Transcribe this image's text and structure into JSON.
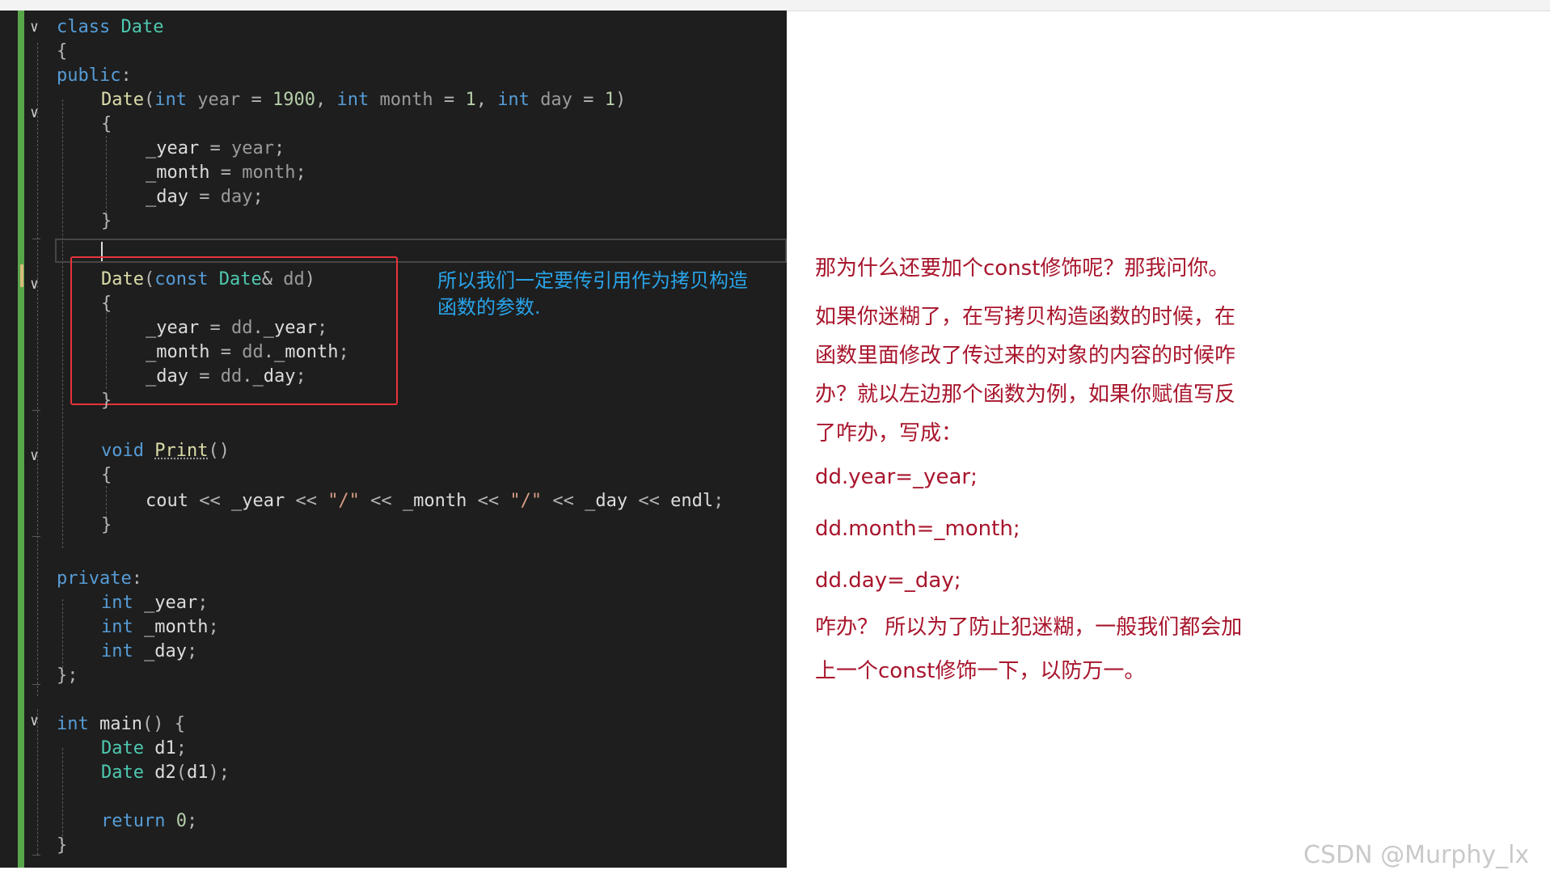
{
  "code": {
    "l1": [
      "class",
      " ",
      "Date"
    ],
    "l2": [
      "{"
    ],
    "l3": [
      "public",
      ":"
    ],
    "l4": [
      "Date",
      "(",
      "int",
      " ",
      "year",
      " = ",
      "1900",
      ", ",
      "int",
      " ",
      "month",
      " = ",
      "1",
      ", ",
      "int",
      " ",
      "day",
      " = ",
      "1",
      ")"
    ],
    "l5": [
      "{"
    ],
    "l6": [
      "_year",
      " = ",
      "year",
      ";"
    ],
    "l7": [
      "_month",
      " = ",
      "month",
      ";"
    ],
    "l8": [
      "_day",
      " = ",
      "day",
      ";"
    ],
    "l9": [
      "}"
    ],
    "l11": [
      "Date",
      "(",
      "const",
      " ",
      "Date",
      "& ",
      "dd",
      ")"
    ],
    "l12": [
      "{"
    ],
    "l13": [
      "_year",
      " = ",
      "dd",
      ".",
      "_year",
      ";"
    ],
    "l14": [
      "_month",
      " = ",
      "dd",
      ".",
      "_month",
      ";"
    ],
    "l15": [
      "_day",
      " = ",
      "dd",
      ".",
      "_day",
      ";"
    ],
    "l16": [
      "}"
    ],
    "l18": [
      "void",
      " ",
      "Print",
      "()"
    ],
    "l19": [
      "{"
    ],
    "l20": [
      "cout",
      " << ",
      "_year",
      " << ",
      "\"/\"",
      " << ",
      "_month",
      " << ",
      "\"/\"",
      " << ",
      "_day",
      " << ",
      "endl",
      ";"
    ],
    "l21": [
      "}"
    ],
    "l23": [
      "private",
      ":"
    ],
    "l24": [
      "int",
      " ",
      "_year",
      ";"
    ],
    "l25": [
      "int",
      " ",
      "_month",
      ";"
    ],
    "l26": [
      "int",
      " ",
      "_day",
      ";"
    ],
    "l27": [
      "};"
    ],
    "l29": [
      "int",
      " ",
      "main",
      "() {"
    ],
    "l30": [
      "Date",
      " ",
      "d1",
      ";"
    ],
    "l31": [
      "Date",
      " ",
      "d2",
      "(",
      "d1",
      ");"
    ],
    "l33": [
      "return",
      " ",
      "0",
      ";"
    ],
    "l34": [
      "}"
    ]
  },
  "annotation": {
    "line1": "所以我们一定要传引用作为拷贝构造",
    "line2": "函数的参数."
  },
  "notes": [
    "那为什么还要加个const修饰呢？那我问你。",
    "如果你迷糊了，在写拷贝构造函数的时候，在",
    "函数里面修改了传过来的对象的内容的时候咋",
    "办？就以左边那个函数为例，如果你赋值写反",
    "了咋办，写成：",
    "dd.year=_year;",
    "dd.month=_month;",
    "dd.day=_day;",
    "咋办？ 所以为了防止犯迷糊，一般我们都会加",
    "上一个const修饰一下，以防万一。"
  ],
  "watermark": "CSDN @Murphy_lx",
  "colors": {
    "editor_bg": "#1e1e1e",
    "keyword": "#569cd6",
    "type": "#4ec9b0",
    "function": "#dcdcaa",
    "number": "#b5cea8",
    "string": "#d69d85",
    "highlight_box": "#e8333a",
    "annotation": "#29a3e8",
    "notes": "#a8152c"
  }
}
